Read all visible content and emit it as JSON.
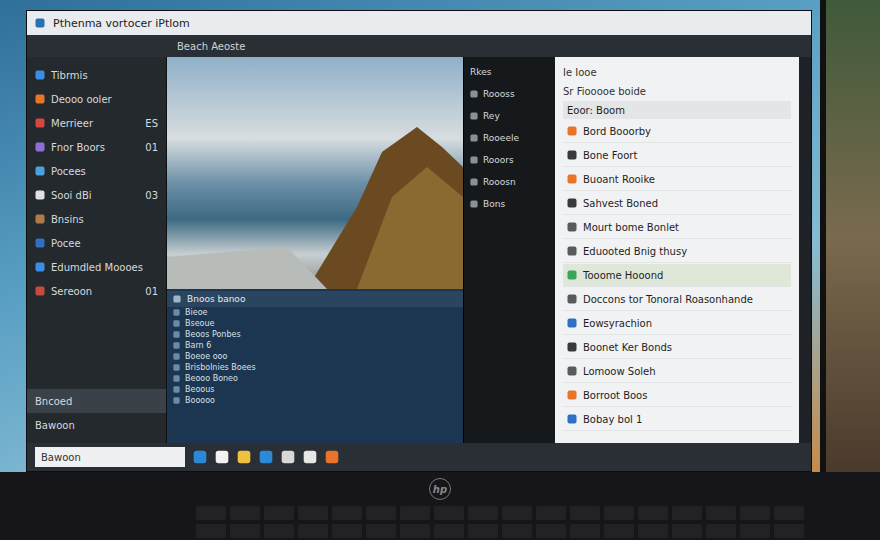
{
  "window": {
    "title": "Pthenma vortocer iPtlom",
    "subtitle": "Beach Aeoste"
  },
  "sidebar": {
    "items": [
      {
        "label": "Tibrmis",
        "count": "",
        "color": "#3a8ee6",
        "selected": false
      },
      {
        "label": "Deooo ooler",
        "count": "",
        "color": "#e8742a",
        "selected": false
      },
      {
        "label": "Merrieer",
        "count": "ES",
        "color": "#d64541",
        "selected": false
      },
      {
        "label": "Fnor Boors",
        "count": "01",
        "color": "#8e6fd8",
        "selected": false
      },
      {
        "label": "Pocees",
        "count": "",
        "color": "#4aa3df",
        "selected": false
      },
      {
        "label": "Sooi dBi",
        "count": "03",
        "color": "#e0e0e0",
        "selected": false
      },
      {
        "label": "Bnsins",
        "count": "",
        "color": "#b07a4a",
        "selected": false
      },
      {
        "label": "Pocee",
        "count": "",
        "color": "#2f6fc4",
        "selected": false
      },
      {
        "label": "Edumdled Moooes",
        "count": "",
        "color": "#3a8ee6",
        "selected": false
      },
      {
        "label": "Sereoon",
        "count": "01",
        "color": "#c94a3a",
        "selected": false
      }
    ],
    "footer": [
      {
        "label": "Bncoed",
        "selected": true
      },
      {
        "label": "Bawoon",
        "selected": false
      }
    ]
  },
  "files": {
    "header": "Bnoos banoo",
    "items": [
      "Bieoe",
      "Bseoue",
      "Beoos Ponbes",
      "Barn 6",
      "Boeoe ooo",
      "Brisbolnies Boees",
      "Beooo Boneo",
      "Beoous",
      "Booooo"
    ]
  },
  "folders": {
    "header": "Rkes",
    "items": [
      "Roooss",
      "Rey",
      "Rooeele",
      "Rooors",
      "Rooosn",
      "Bons"
    ]
  },
  "details": {
    "title": "Ie Iooe",
    "subtitle": "Sr Fiooooe boide",
    "filter": "Eoor: Boom",
    "items": [
      {
        "label": "Bord Booorby",
        "color": "#e8742a",
        "selected": false
      },
      {
        "label": "Bone Foort",
        "color": "#3a3a3a",
        "selected": false
      },
      {
        "label": "Buoant Rooike",
        "color": "#e8742a",
        "selected": false
      },
      {
        "label": "Sahvest Boned",
        "color": "#3a3a3a",
        "selected": false
      },
      {
        "label": "Mourt bome Bonlet",
        "color": "#5a5a5a",
        "selected": false
      },
      {
        "label": "Eduooted Bnig thusy",
        "color": "#5a5a5a",
        "selected": false
      },
      {
        "label": "Tooome Hooond",
        "color": "#3aa55a",
        "selected": true
      },
      {
        "label": "Doccons tor Tonoral Roasonhande",
        "color": "#5a5a5a",
        "selected": false
      },
      {
        "label": "Eowsyrachion",
        "color": "#2f6fc4",
        "selected": false
      },
      {
        "label": "Boonet Ker Bonds",
        "color": "#3a3a3a",
        "selected": false
      },
      {
        "label": "Lomoow Soleh",
        "color": "#5a5a5a",
        "selected": false
      },
      {
        "label": "Borroot Boos",
        "color": "#e8742a",
        "selected": false
      },
      {
        "label": "Bobay bol 1",
        "color": "#2f6fc4",
        "selected": false
      }
    ]
  },
  "taskbar": {
    "search": "Bawoon",
    "apps": [
      {
        "color": "#2a8ad8"
      },
      {
        "color": "#f2f2f2"
      },
      {
        "color": "#f0c040"
      },
      {
        "color": "#2a8ad8"
      },
      {
        "color": "#d8d8d8"
      },
      {
        "color": "#e6e6e6"
      },
      {
        "color": "#e8742a"
      }
    ]
  },
  "logo": "hp"
}
